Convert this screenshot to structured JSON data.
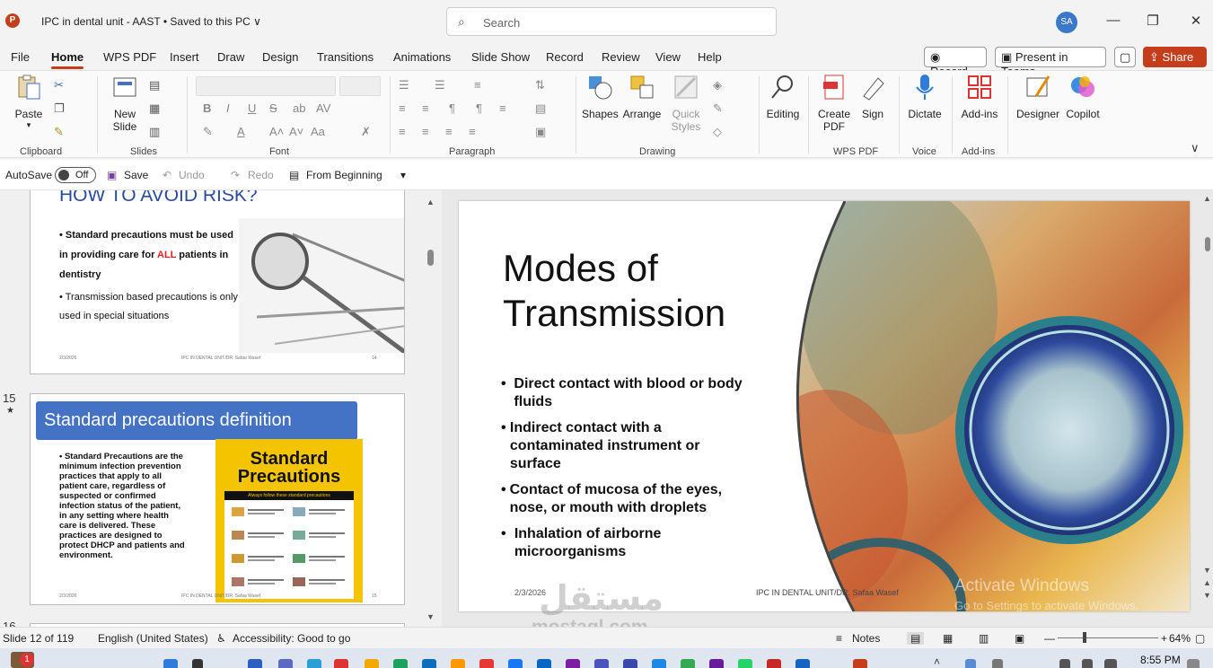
{
  "titlebar": {
    "app_letter": "P",
    "doc_title": "IPC in dental unit - AAST  •  Saved to this PC ∨",
    "search_placeholder": "Search",
    "avatar": "SA"
  },
  "menu": {
    "tabs": [
      "File",
      "Home",
      "WPS PDF",
      "Insert",
      "Draw",
      "Design",
      "Transitions",
      "Animations",
      "Slide Show",
      "Record",
      "Review",
      "View",
      "Help"
    ],
    "active_tab": "Home",
    "record_label": "Record",
    "present_label": "Present in Teams",
    "share_label": "Share"
  },
  "ribbon": {
    "paste": "Paste",
    "new_slide": "New Slide",
    "shapes": "Shapes",
    "arrange": "Arrange",
    "quick_styles": "Quick Styles",
    "editing": "Editing",
    "create_pdf": "Create PDF",
    "sign": "Sign",
    "dictate": "Dictate",
    "add_ins": "Add-ins",
    "designer": "Designer",
    "copilot": "Copilot",
    "groups": [
      "Clipboard",
      "Slides",
      "Font",
      "Paragraph",
      "Drawing",
      "WPS PDF",
      "Voice",
      "Add-ins"
    ]
  },
  "quick_access": {
    "autosave": "AutoSave",
    "toggle": "Off",
    "save": "Save",
    "undo": "Undo",
    "redo": "Redo",
    "from_beginning": "From Beginning"
  },
  "thumb14": {
    "title": "HOW TO AVOID RISK?",
    "bullet1_pre": "Standard precautions must be used in providing care for ",
    "bullet1_red": "ALL",
    "bullet1_post": " patients in dentistry",
    "bullet2": "Transmission based precautions is only used in special situations",
    "footer_date": "2/3/2026",
    "footer_center": "IPC IN DENTAL UNIT/DR. Safaa Wasef",
    "footer_num": "14"
  },
  "thumb15": {
    "number": "15",
    "star": "★",
    "title": "Standard precautions definition",
    "body": "Standard Precautions are the minimum infection prevention practices that apply to all patient care, regardless of suspected or confirmed infection status of the patient, in any setting where health care is delivered. These practices are designed to protect DHCP and patients and environment.",
    "poster_title": "Standard Precautions",
    "poster_banner": "Always follow these standard precautions",
    "footer_date": "2/3/2026",
    "footer_center": "IPC IN DENTAL UNIT/DR. Safaa Wasef",
    "footer_num": "15"
  },
  "thumb16": {
    "number": "16"
  },
  "main_slide": {
    "title_line1": "Modes of",
    "title_line2": "Transmission",
    "bullets": [
      "Direct contact with blood or body fluids",
      "Indirect contact with a contaminated instrument or surface",
      "Contact of mucosa of the eyes, nose, or mouth with droplets",
      "Inhalation of airborne microorganisms"
    ],
    "footer_date": "2/3/2026",
    "footer_center": "IPC IN DENTAL UNIT/DR. Safaa Wasef"
  },
  "activation": {
    "line1": "Activate Windows",
    "line2": "Go to Settings to activate Windows."
  },
  "statusbar": {
    "slide_info": "Slide 12 of 119",
    "language": "English (United States)",
    "accessibility": "Accessibility: Good to go",
    "notes": "Notes",
    "zoom": "64%"
  },
  "taskbar": {
    "time": "8:55 PM",
    "notif_count": "1"
  },
  "watermark": {
    "arabic": "مستقل",
    "latin": "mostaql.com"
  },
  "colors": {
    "accent": "#c43e1c",
    "slide15_title_bg": "#4472c4",
    "poster_yellow": "#f5c400",
    "red_text": "#e02020"
  }
}
